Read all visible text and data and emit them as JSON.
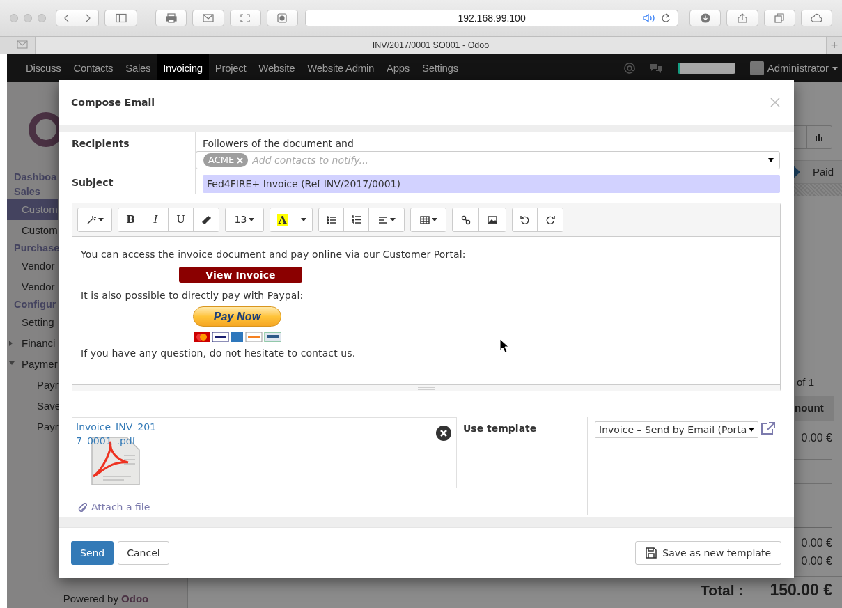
{
  "browser": {
    "url": "192.168.99.100",
    "tab_title": "INV/2017/0001 SO001 - Odoo",
    "new_tab": "+"
  },
  "navbar": {
    "menus": [
      {
        "label": "Discuss",
        "selected": false
      },
      {
        "label": "Contacts",
        "selected": false
      },
      {
        "label": "Sales",
        "selected": false
      },
      {
        "label": "Invoicing",
        "selected": true
      },
      {
        "label": "Project",
        "selected": false
      },
      {
        "label": "Website",
        "selected": false
      },
      {
        "label": "Website Admin",
        "selected": false
      },
      {
        "label": "Apps",
        "selected": false
      },
      {
        "label": "Settings",
        "selected": false
      }
    ],
    "user": "Administrator"
  },
  "sidebar": {
    "items": [
      {
        "kind": "heading",
        "label": "Dashboa"
      },
      {
        "kind": "heading",
        "label": "Sales"
      },
      {
        "kind": "item",
        "label": "Custom",
        "selected": true
      },
      {
        "kind": "item",
        "label": "Custom",
        "selected": false
      },
      {
        "kind": "heading",
        "label": "Purchase"
      },
      {
        "kind": "item",
        "label": "Vendor",
        "selected": false
      },
      {
        "kind": "item",
        "label": "Vendor",
        "selected": false
      },
      {
        "kind": "heading",
        "label": "Configur"
      },
      {
        "kind": "item",
        "label": "Setting",
        "selected": false
      },
      {
        "kind": "folder",
        "label": "Financi",
        "expanded": false
      },
      {
        "kind": "folder",
        "label": "Paymer",
        "expanded": true,
        "children": [
          {
            "kind": "item",
            "label": "Payr",
            "selected": false
          },
          {
            "kind": "item",
            "label": "Save",
            "selected": false
          },
          {
            "kind": "item",
            "label": "Payr",
            "selected": false
          }
        ]
      }
    ],
    "footer_prefix": "Powered by",
    "footer_brand": "Odoo"
  },
  "record": {
    "status": "Paid",
    "pager": "of 1",
    "column": "nount",
    "line_amount": "0.00 €",
    "subtotals": [
      "0.00 €",
      "0.00 €"
    ],
    "total_label": "Total :",
    "total": "150.00 €"
  },
  "dialog": {
    "title": "Compose Email",
    "recipients": {
      "label": "Recipients",
      "note": "Followers of the document and",
      "tags": [
        "ACME"
      ],
      "placeholder": "Add contacts to notify..."
    },
    "subject": {
      "label": "Subject",
      "value": "Fed4FIRE+ Invoice (Ref INV/2017/0001)"
    },
    "toolbar": {
      "bold": "B",
      "italic": "I",
      "underline": "U",
      "font_size": "13",
      "highlight": "A"
    },
    "body": [
      {
        "kind": "paragraph",
        "text": "You can access the invoice document and pay online via our Customer Portal:"
      },
      {
        "kind": "button",
        "text": "View Invoice"
      },
      {
        "kind": "paragraph",
        "text": "It is also possible to directly pay with Paypal:"
      },
      {
        "kind": "paypal",
        "text": "Pay Now"
      },
      {
        "kind": "paragraph",
        "text": "If you have any question, do not hesitate to contact us."
      }
    ],
    "attachments": [
      {
        "name": "Invoice_INV_2017_0001_.pdf"
      }
    ],
    "attach_link": "Attach a file",
    "template": {
      "label": "Use template",
      "value": "Invoice – Send by Email (Porta"
    },
    "buttons": {
      "send": "Send",
      "cancel": "Cancel",
      "save_template": "Save as new template"
    }
  }
}
